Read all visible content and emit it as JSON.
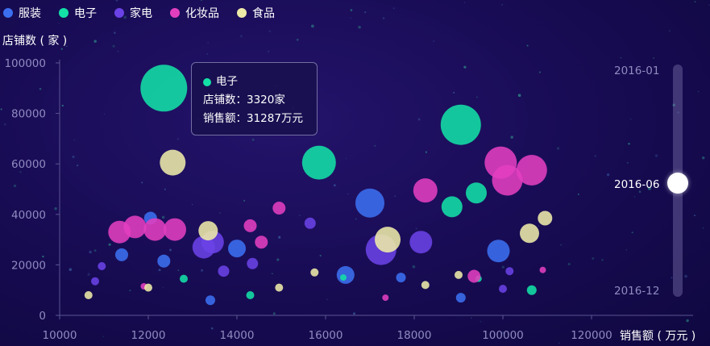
{
  "legend": [
    {
      "name": "服装",
      "color": "#3b6ff0"
    },
    {
      "name": "电子",
      "color": "#13e0a6"
    },
    {
      "name": "家电",
      "color": "#6a42e6"
    },
    {
      "name": "化妆品",
      "color": "#e23fbf"
    },
    {
      "name": "食品",
      "color": "#eeeaa8"
    }
  ],
  "tooltip": {
    "series": "电子",
    "line1": "店铺数：3320家",
    "line2": "销售额：31287万元",
    "color": "#13e0a6"
  },
  "timeline": {
    "labels": [
      "2016-01",
      "2016-06",
      "2016-12"
    ],
    "current": "2016-06"
  },
  "chart_data": {
    "type": "scatter",
    "xlabel": "销售额 ( 万元 )",
    "ylabel": "店铺数 ( 家 )",
    "x_ticks": [
      "10000",
      "12000",
      "14000",
      "16000",
      "18000",
      "100000",
      "120000"
    ],
    "y_ticks": [
      "0",
      "20000",
      "40000",
      "60000",
      "80000",
      "100000"
    ],
    "ylim": [
      0,
      100000
    ],
    "series": [
      {
        "name": "服装",
        "color": "#3b6ff0",
        "points": [
          {
            "x": 12050,
            "y": 38500,
            "size": 8
          },
          {
            "x": 11400,
            "y": 24000,
            "size": 8
          },
          {
            "x": 12350,
            "y": 21500,
            "size": 8
          },
          {
            "x": 13400,
            "y": 6000,
            "size": 6
          },
          {
            "x": 14000,
            "y": 26500,
            "size": 11
          },
          {
            "x": 16450,
            "y": 16000,
            "size": 11
          },
          {
            "x": 17000,
            "y": 44500,
            "size": 18
          },
          {
            "x": 17700,
            "y": 15000,
            "size": 6
          },
          {
            "x": 19050,
            "y": 7000,
            "size": 6
          },
          {
            "x": 19900,
            "y": 25500,
            "size": 14
          }
        ]
      },
      {
        "name": "电子",
        "color": "#13e0a6",
        "points": [
          {
            "x": 12350,
            "y": 90000,
            "size": 29
          },
          {
            "x": 12800,
            "y": 14500,
            "size": 5
          },
          {
            "x": 14300,
            "y": 8000,
            "size": 5
          },
          {
            "x": 15850,
            "y": 60500,
            "size": 21
          },
          {
            "x": 16400,
            "y": 15000,
            "size": 4
          },
          {
            "x": 19050,
            "y": 75500,
            "size": 25
          },
          {
            "x": 18850,
            "y": 43000,
            "size": 13
          },
          {
            "x": 19400,
            "y": 48500,
            "size": 13
          },
          {
            "x": 19450,
            "y": 14500,
            "size": 4
          },
          {
            "x": 20650,
            "y": 10000,
            "size": 6
          }
        ]
      },
      {
        "name": "家电",
        "color": "#6a42e6",
        "points": [
          {
            "x": 10800,
            "y": 13500,
            "size": 5
          },
          {
            "x": 10950,
            "y": 19500,
            "size": 5
          },
          {
            "x": 13250,
            "y": 27000,
            "size": 14
          },
          {
            "x": 13450,
            "y": 29000,
            "size": 14
          },
          {
            "x": 13700,
            "y": 17500,
            "size": 7
          },
          {
            "x": 14350,
            "y": 20500,
            "size": 7
          },
          {
            "x": 15650,
            "y": 36500,
            "size": 7
          },
          {
            "x": 17250,
            "y": 26000,
            "size": 19
          },
          {
            "x": 18150,
            "y": 29000,
            "size": 14
          },
          {
            "x": 20000,
            "y": 10500,
            "size": 5
          },
          {
            "x": 20150,
            "y": 17500,
            "size": 5
          }
        ]
      },
      {
        "name": "化妆品",
        "color": "#e23fbf",
        "points": [
          {
            "x": 11350,
            "y": 33000,
            "size": 14
          },
          {
            "x": 11700,
            "y": 35000,
            "size": 14
          },
          {
            "x": 12150,
            "y": 34000,
            "size": 14
          },
          {
            "x": 12600,
            "y": 34000,
            "size": 14
          },
          {
            "x": 11900,
            "y": 11500,
            "size": 4
          },
          {
            "x": 14300,
            "y": 35500,
            "size": 8
          },
          {
            "x": 14550,
            "y": 29000,
            "size": 8
          },
          {
            "x": 14950,
            "y": 42500,
            "size": 8
          },
          {
            "x": 17350,
            "y": 7000,
            "size": 4
          },
          {
            "x": 18250,
            "y": 49500,
            "size": 15
          },
          {
            "x": 19350,
            "y": 15500,
            "size": 8
          },
          {
            "x": 19950,
            "y": 60500,
            "size": 20
          },
          {
            "x": 20100,
            "y": 53500,
            "size": 19
          },
          {
            "x": 20650,
            "y": 57500,
            "size": 19
          },
          {
            "x": 20900,
            "y": 18000,
            "size": 4
          }
        ]
      },
      {
        "name": "食品",
        "color": "#eeeaa8",
        "points": [
          {
            "x": 10650,
            "y": 8000,
            "size": 5
          },
          {
            "x": 12000,
            "y": 11000,
            "size": 5
          },
          {
            "x": 12550,
            "y": 60500,
            "size": 16
          },
          {
            "x": 13350,
            "y": 33500,
            "size": 12
          },
          {
            "x": 14950,
            "y": 11000,
            "size": 5
          },
          {
            "x": 15750,
            "y": 17000,
            "size": 5
          },
          {
            "x": 17400,
            "y": 30000,
            "size": 16
          },
          {
            "x": 18250,
            "y": 12000,
            "size": 5
          },
          {
            "x": 19000,
            "y": 16000,
            "size": 5
          },
          {
            "x": 20600,
            "y": 32500,
            "size": 12
          },
          {
            "x": 20950,
            "y": 38500,
            "size": 9
          }
        ]
      }
    ]
  }
}
